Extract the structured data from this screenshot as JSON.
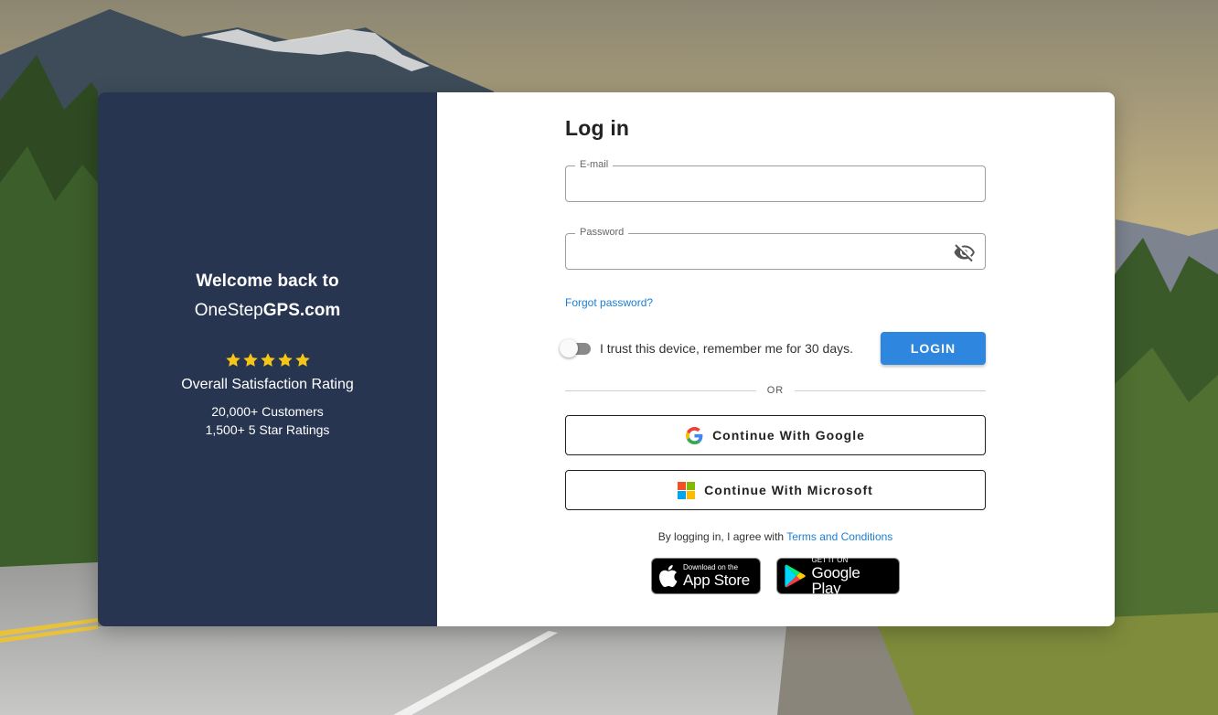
{
  "brand": {
    "welcome_line1": "Welcome back to",
    "site_name_prefix": "OneStep",
    "site_name_bold": "GPS.com",
    "star_count": 5,
    "star_color": "#f5c518",
    "rating_label": "Overall Satisfaction Rating",
    "stats": [
      "20,000+ Customers",
      "1,500+ 5 Star Ratings"
    ],
    "panel_color": "#283550"
  },
  "login": {
    "title": "Log in",
    "email_label": "E-mail",
    "email_value": "",
    "password_label": "Password",
    "password_value": "",
    "password_toggle_icon": "eye-off-icon",
    "forgot_password": "Forgot password?",
    "trust_device_label": "I trust this device, remember me for 30 days.",
    "trust_device_on": false,
    "login_button": "LOGIN",
    "accent_color": "#2e86de",
    "divider_text": "OR",
    "google_button": "Continue With Google",
    "microsoft_button": "Continue With Microsoft",
    "terms_prefix": "By logging in, I agree with",
    "terms_link": "Terms and Conditions"
  },
  "stores": {
    "apple_small": "Download on the",
    "apple_big": "App Store",
    "google_small": "GET IT ON",
    "google_big": "Google Play"
  }
}
